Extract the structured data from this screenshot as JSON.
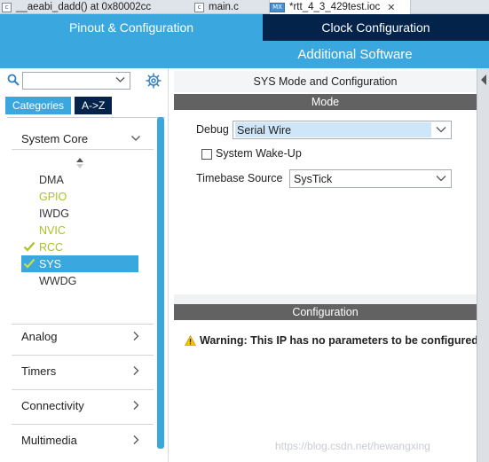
{
  "editor_tabs": [
    {
      "icon_label": "c",
      "label": "__aeabi_dadd() at 0x80002cc"
    },
    {
      "icon_label": "c",
      "label": "main.c"
    },
    {
      "icon_label": "MX",
      "label": "*rtt_4_3_429test.ioc",
      "close": "✕"
    }
  ],
  "header": {
    "pinout_tab": "Pinout & Configuration",
    "clock_tab": "Clock Configuration",
    "additional_tab": "Additional Software"
  },
  "left_panel": {
    "search_placeholder": "",
    "subtabs": [
      "Categories",
      "A->Z"
    ],
    "categories": [
      {
        "label": "System Core",
        "expanded": true
      },
      {
        "label": "Analog",
        "expanded": false
      },
      {
        "label": "Timers",
        "expanded": false
      },
      {
        "label": "Connectivity",
        "expanded": false
      },
      {
        "label": "Multimedia",
        "expanded": false
      }
    ],
    "system_core_items": [
      {
        "label": "DMA",
        "state": "normal"
      },
      {
        "label": "GPIO",
        "state": "configured"
      },
      {
        "label": "IWDG",
        "state": "normal"
      },
      {
        "label": "NVIC",
        "state": "configured"
      },
      {
        "label": "RCC",
        "state": "checked"
      },
      {
        "label": "SYS",
        "state": "selected"
      },
      {
        "label": "WWDG",
        "state": "normal"
      }
    ]
  },
  "content": {
    "title": "SYS Mode and Configuration",
    "mode_header": "Mode",
    "debug_label": "Debug",
    "debug_value": "Serial Wire",
    "wakeup_label": "System Wake-Up",
    "wakeup_checked": false,
    "timebase_label": "Timebase Source",
    "timebase_value": "SysTick",
    "config_header": "Configuration",
    "warning": "Warning: This IP has no parameters to be configured."
  },
  "watermark": "https://blog.csdn.net/hewangxing",
  "colors": {
    "accent_blue": "#3aa8df",
    "dark_navy": "#03234b",
    "section_gray": "#626262",
    "configured_green": "#a7c421",
    "warning_yellow": "#f5c400"
  },
  "icons": [
    "magnifier-icon",
    "gear-icon",
    "chevron-down-icon",
    "chevron-right-icon",
    "checkmark-icon",
    "sort-arrows-icon",
    "warning-icon",
    "close-icon"
  ]
}
